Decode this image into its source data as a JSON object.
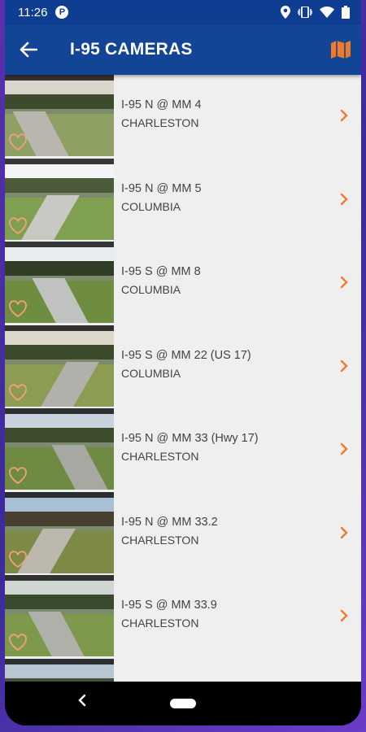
{
  "status_bar": {
    "time": "11:26",
    "notification_icon": "p-icon",
    "icons": [
      "location-icon",
      "vibrate-icon",
      "wifi-icon",
      "battery-icon"
    ]
  },
  "app_bar": {
    "title": "I-95 CAMERAS",
    "back_icon": "arrow-left-icon",
    "map_icon": "map-icon",
    "accent": "#f07a2c",
    "background": "#134596"
  },
  "cameras": [
    {
      "name": "I-95 N @ MM 4",
      "city": "CHARLESTON"
    },
    {
      "name": "I-95 N @ MM 5",
      "city": "COLUMBIA"
    },
    {
      "name": "I-95 S @ MM 8",
      "city": "COLUMBIA"
    },
    {
      "name": "I-95 S @ MM 22 (US 17)",
      "city": "COLUMBIA"
    },
    {
      "name": "I-95 N @ MM 33 (Hwy 17)",
      "city": "CHARLESTON"
    },
    {
      "name": "I-95 N @ MM 33.2",
      "city": "CHARLESTON"
    },
    {
      "name": "I-95 S @ MM 33.9",
      "city": "CHARLESTON"
    },
    {
      "name": "",
      "city": ""
    }
  ],
  "nav_bar": {
    "back_icon": "nav-back-icon",
    "home_icon": "nav-home-pill"
  }
}
